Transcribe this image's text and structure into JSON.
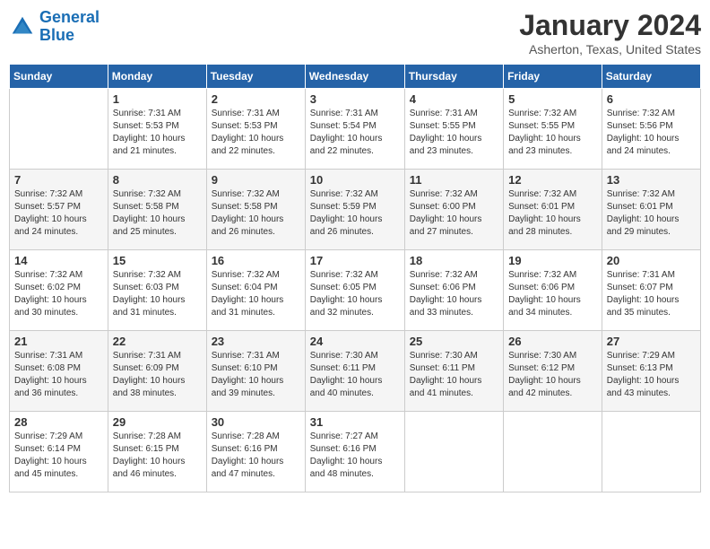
{
  "logo": {
    "text_general": "General",
    "text_blue": "Blue"
  },
  "title": "January 2024",
  "location": "Asherton, Texas, United States",
  "header_days": [
    "Sunday",
    "Monday",
    "Tuesday",
    "Wednesday",
    "Thursday",
    "Friday",
    "Saturday"
  ],
  "weeks": [
    [
      {
        "day": "",
        "info": ""
      },
      {
        "day": "1",
        "info": "Sunrise: 7:31 AM\nSunset: 5:53 PM\nDaylight: 10 hours\nand 21 minutes."
      },
      {
        "day": "2",
        "info": "Sunrise: 7:31 AM\nSunset: 5:53 PM\nDaylight: 10 hours\nand 22 minutes."
      },
      {
        "day": "3",
        "info": "Sunrise: 7:31 AM\nSunset: 5:54 PM\nDaylight: 10 hours\nand 22 minutes."
      },
      {
        "day": "4",
        "info": "Sunrise: 7:31 AM\nSunset: 5:55 PM\nDaylight: 10 hours\nand 23 minutes."
      },
      {
        "day": "5",
        "info": "Sunrise: 7:32 AM\nSunset: 5:55 PM\nDaylight: 10 hours\nand 23 minutes."
      },
      {
        "day": "6",
        "info": "Sunrise: 7:32 AM\nSunset: 5:56 PM\nDaylight: 10 hours\nand 24 minutes."
      }
    ],
    [
      {
        "day": "7",
        "info": "Sunrise: 7:32 AM\nSunset: 5:57 PM\nDaylight: 10 hours\nand 24 minutes."
      },
      {
        "day": "8",
        "info": "Sunrise: 7:32 AM\nSunset: 5:58 PM\nDaylight: 10 hours\nand 25 minutes."
      },
      {
        "day": "9",
        "info": "Sunrise: 7:32 AM\nSunset: 5:58 PM\nDaylight: 10 hours\nand 26 minutes."
      },
      {
        "day": "10",
        "info": "Sunrise: 7:32 AM\nSunset: 5:59 PM\nDaylight: 10 hours\nand 26 minutes."
      },
      {
        "day": "11",
        "info": "Sunrise: 7:32 AM\nSunset: 6:00 PM\nDaylight: 10 hours\nand 27 minutes."
      },
      {
        "day": "12",
        "info": "Sunrise: 7:32 AM\nSunset: 6:01 PM\nDaylight: 10 hours\nand 28 minutes."
      },
      {
        "day": "13",
        "info": "Sunrise: 7:32 AM\nSunset: 6:01 PM\nDaylight: 10 hours\nand 29 minutes."
      }
    ],
    [
      {
        "day": "14",
        "info": "Sunrise: 7:32 AM\nSunset: 6:02 PM\nDaylight: 10 hours\nand 30 minutes."
      },
      {
        "day": "15",
        "info": "Sunrise: 7:32 AM\nSunset: 6:03 PM\nDaylight: 10 hours\nand 31 minutes."
      },
      {
        "day": "16",
        "info": "Sunrise: 7:32 AM\nSunset: 6:04 PM\nDaylight: 10 hours\nand 31 minutes."
      },
      {
        "day": "17",
        "info": "Sunrise: 7:32 AM\nSunset: 6:05 PM\nDaylight: 10 hours\nand 32 minutes."
      },
      {
        "day": "18",
        "info": "Sunrise: 7:32 AM\nSunset: 6:06 PM\nDaylight: 10 hours\nand 33 minutes."
      },
      {
        "day": "19",
        "info": "Sunrise: 7:32 AM\nSunset: 6:06 PM\nDaylight: 10 hours\nand 34 minutes."
      },
      {
        "day": "20",
        "info": "Sunrise: 7:31 AM\nSunset: 6:07 PM\nDaylight: 10 hours\nand 35 minutes."
      }
    ],
    [
      {
        "day": "21",
        "info": "Sunrise: 7:31 AM\nSunset: 6:08 PM\nDaylight: 10 hours\nand 36 minutes."
      },
      {
        "day": "22",
        "info": "Sunrise: 7:31 AM\nSunset: 6:09 PM\nDaylight: 10 hours\nand 38 minutes."
      },
      {
        "day": "23",
        "info": "Sunrise: 7:31 AM\nSunset: 6:10 PM\nDaylight: 10 hours\nand 39 minutes."
      },
      {
        "day": "24",
        "info": "Sunrise: 7:30 AM\nSunset: 6:11 PM\nDaylight: 10 hours\nand 40 minutes."
      },
      {
        "day": "25",
        "info": "Sunrise: 7:30 AM\nSunset: 6:11 PM\nDaylight: 10 hours\nand 41 minutes."
      },
      {
        "day": "26",
        "info": "Sunrise: 7:30 AM\nSunset: 6:12 PM\nDaylight: 10 hours\nand 42 minutes."
      },
      {
        "day": "27",
        "info": "Sunrise: 7:29 AM\nSunset: 6:13 PM\nDaylight: 10 hours\nand 43 minutes."
      }
    ],
    [
      {
        "day": "28",
        "info": "Sunrise: 7:29 AM\nSunset: 6:14 PM\nDaylight: 10 hours\nand 45 minutes."
      },
      {
        "day": "29",
        "info": "Sunrise: 7:28 AM\nSunset: 6:15 PM\nDaylight: 10 hours\nand 46 minutes."
      },
      {
        "day": "30",
        "info": "Sunrise: 7:28 AM\nSunset: 6:16 PM\nDaylight: 10 hours\nand 47 minutes."
      },
      {
        "day": "31",
        "info": "Sunrise: 7:27 AM\nSunset: 6:16 PM\nDaylight: 10 hours\nand 48 minutes."
      },
      {
        "day": "",
        "info": ""
      },
      {
        "day": "",
        "info": ""
      },
      {
        "day": "",
        "info": ""
      }
    ]
  ]
}
